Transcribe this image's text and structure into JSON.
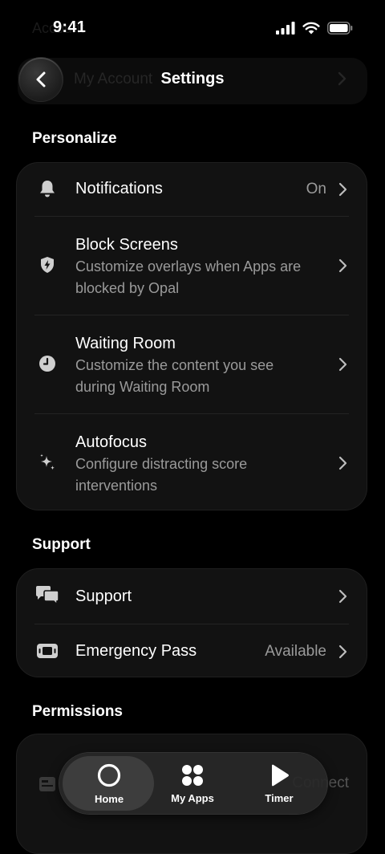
{
  "status": {
    "time": "9:41"
  },
  "header": {
    "title": "Settings",
    "behind_text": "My Account",
    "behind_top": "Account"
  },
  "sections": {
    "personalize": "Personalize",
    "support": "Support",
    "permissions": "Permissions"
  },
  "personalize_rows": [
    {
      "label": "Notifications",
      "value": "On",
      "icon": "bell-icon"
    },
    {
      "label": "Block Screens",
      "sub": "Customize overlays when Apps are blocked by Opal",
      "icon": "shield-bolt-icon"
    },
    {
      "label": "Waiting Room",
      "sub": "Customize the content you see during Waiting Room",
      "icon": "clock-icon"
    },
    {
      "label": "Autofocus",
      "sub": "Configure distracting score interventions",
      "icon": "sparkles-icon"
    }
  ],
  "support_rows": [
    {
      "label": "Support",
      "icon": "chat-bubbles-icon"
    },
    {
      "label": "Emergency Pass",
      "value": "Available",
      "icon": "ticket-icon"
    }
  ],
  "permissions_peek": {
    "value": "Connect"
  },
  "tabbar": [
    {
      "label": "Home",
      "icon": "home-ring-icon",
      "active": true
    },
    {
      "label": "My Apps",
      "icon": "grid-dots-icon",
      "active": false
    },
    {
      "label": "Timer",
      "icon": "play-icon",
      "active": false
    }
  ]
}
